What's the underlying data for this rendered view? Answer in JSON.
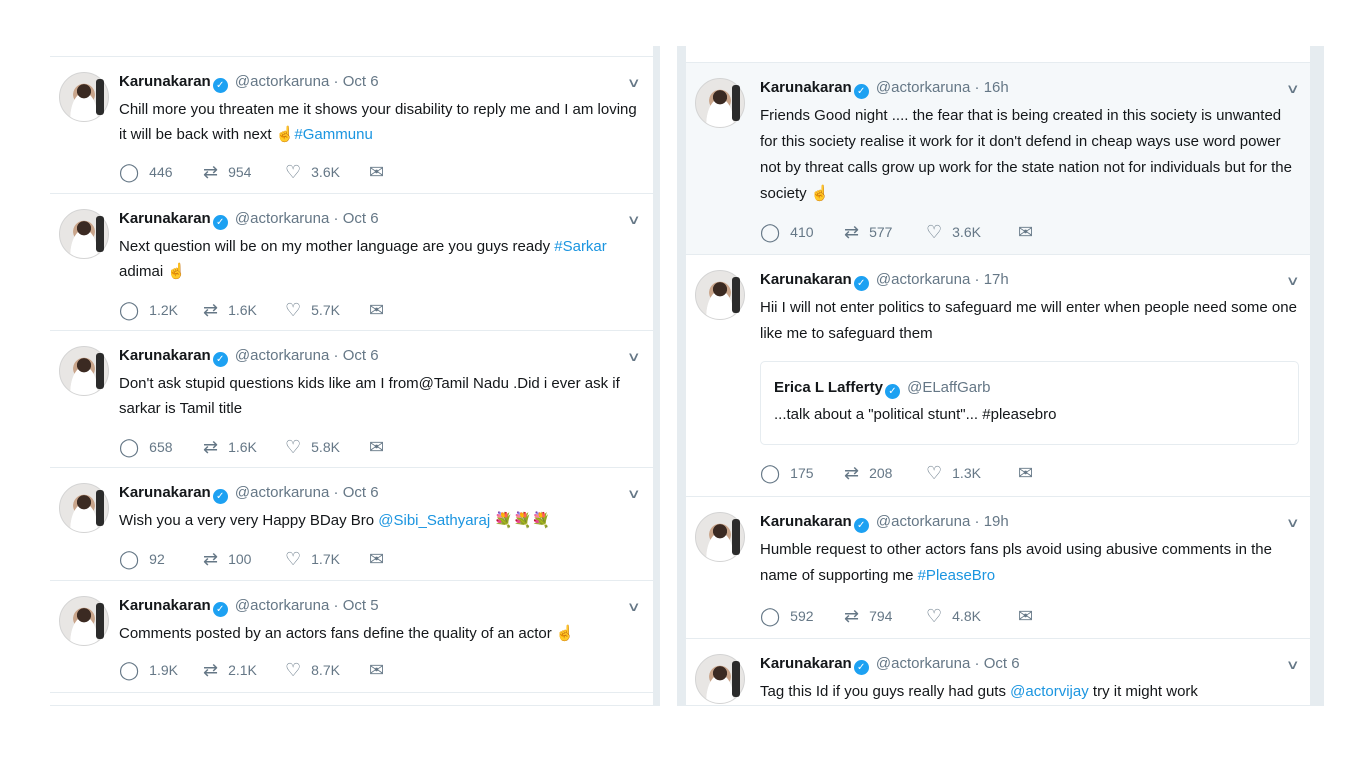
{
  "left_column": {
    "tweets": [
      {
        "name": "Karunakaran",
        "handle": "@actorkaruna",
        "time": "Oct 6",
        "text_plain": "Chill more you threaten me it shows your disability to reply me and I am loving it will be back with next ☝",
        "hashtag": "#Gammunu",
        "replies": "446",
        "retweets": "954",
        "likes": "3.6K"
      },
      {
        "name": "Karunakaran",
        "handle": "@actorkaruna",
        "time": "Oct 6",
        "text_before": "Next question will be on my mother language are you guys ready ",
        "hashtag": "#Sarkar",
        "text_after": " adimai ☝",
        "replies": "1.2K",
        "retweets": "1.6K",
        "likes": "5.7K"
      },
      {
        "name": "Karunakaran",
        "handle": "@actorkaruna",
        "time": "Oct 6",
        "text_plain": "Don't ask stupid questions kids like am I from@Tamil Nadu .Did i ever ask if sarkar is Tamil title",
        "replies": "658",
        "retweets": "1.6K",
        "likes": "5.8K"
      },
      {
        "name": "Karunakaran",
        "handle": "@actorkaruna",
        "time": "Oct 6",
        "text_before": "Wish you a very very Happy BDay Bro ",
        "mention": "@Sibi_Sathyaraj",
        "text_after": " 💐💐💐",
        "replies": "92",
        "retweets": "100",
        "likes": "1.7K"
      },
      {
        "name": "Karunakaran",
        "handle": "@actorkaruna",
        "time": "Oct 5",
        "text_plain": "Comments posted by an actors fans define the quality of an actor ☝",
        "replies": "1.9K",
        "retweets": "2.1K",
        "likes": "8.7K"
      }
    ]
  },
  "right_column": {
    "tweets": [
      {
        "name": "Karunakaran",
        "handle": "@actorkaruna",
        "time": "16h",
        "text_plain": "Friends Good night .... the fear that is being created in this society is unwanted for this society realise it work for it don't defend in cheap ways use word power not by threat calls grow up work for the state nation not for individuals but for the society ☝",
        "replies": "410",
        "retweets": "577",
        "likes": "3.6K"
      },
      {
        "name": "Karunakaran",
        "handle": "@actorkaruna",
        "time": "17h",
        "text_plain": "Hii I will not enter politics to safeguard me will enter when people need some one like me to safeguard them",
        "quote": {
          "name": "Erica L Lafferty",
          "handle": "@ELaffGarb",
          "text": "...talk about a \"political stunt\"... #pleasebro"
        },
        "replies": "175",
        "retweets": "208",
        "likes": "1.3K"
      },
      {
        "name": "Karunakaran",
        "handle": "@actorkaruna",
        "time": "19h",
        "text_before": "Humble request to other actors fans pls avoid using abusive comments in the name of supporting me ",
        "hashtag": "#PleaseBro",
        "replies": "592",
        "retweets": "794",
        "likes": "4.8K"
      },
      {
        "name": "Karunakaran",
        "handle": "@actorkaruna",
        "time": "Oct 6",
        "text_before": "Tag this Id if you guys really had guts ",
        "mention": "@actorvijay",
        "text_after": " try it might work"
      }
    ]
  },
  "ui": {
    "dot": "·",
    "verified_glyph": "✓",
    "chevron": "∨",
    "icons": [
      "reply-icon",
      "retweet-icon",
      "like-icon",
      "direct-message-icon",
      "chevron-down-icon",
      "verified-badge-icon"
    ],
    "colors": {
      "link": "#1b95e0",
      "verified": "#1da1f2",
      "muted": "#657786",
      "border": "#e6ecf0"
    }
  }
}
